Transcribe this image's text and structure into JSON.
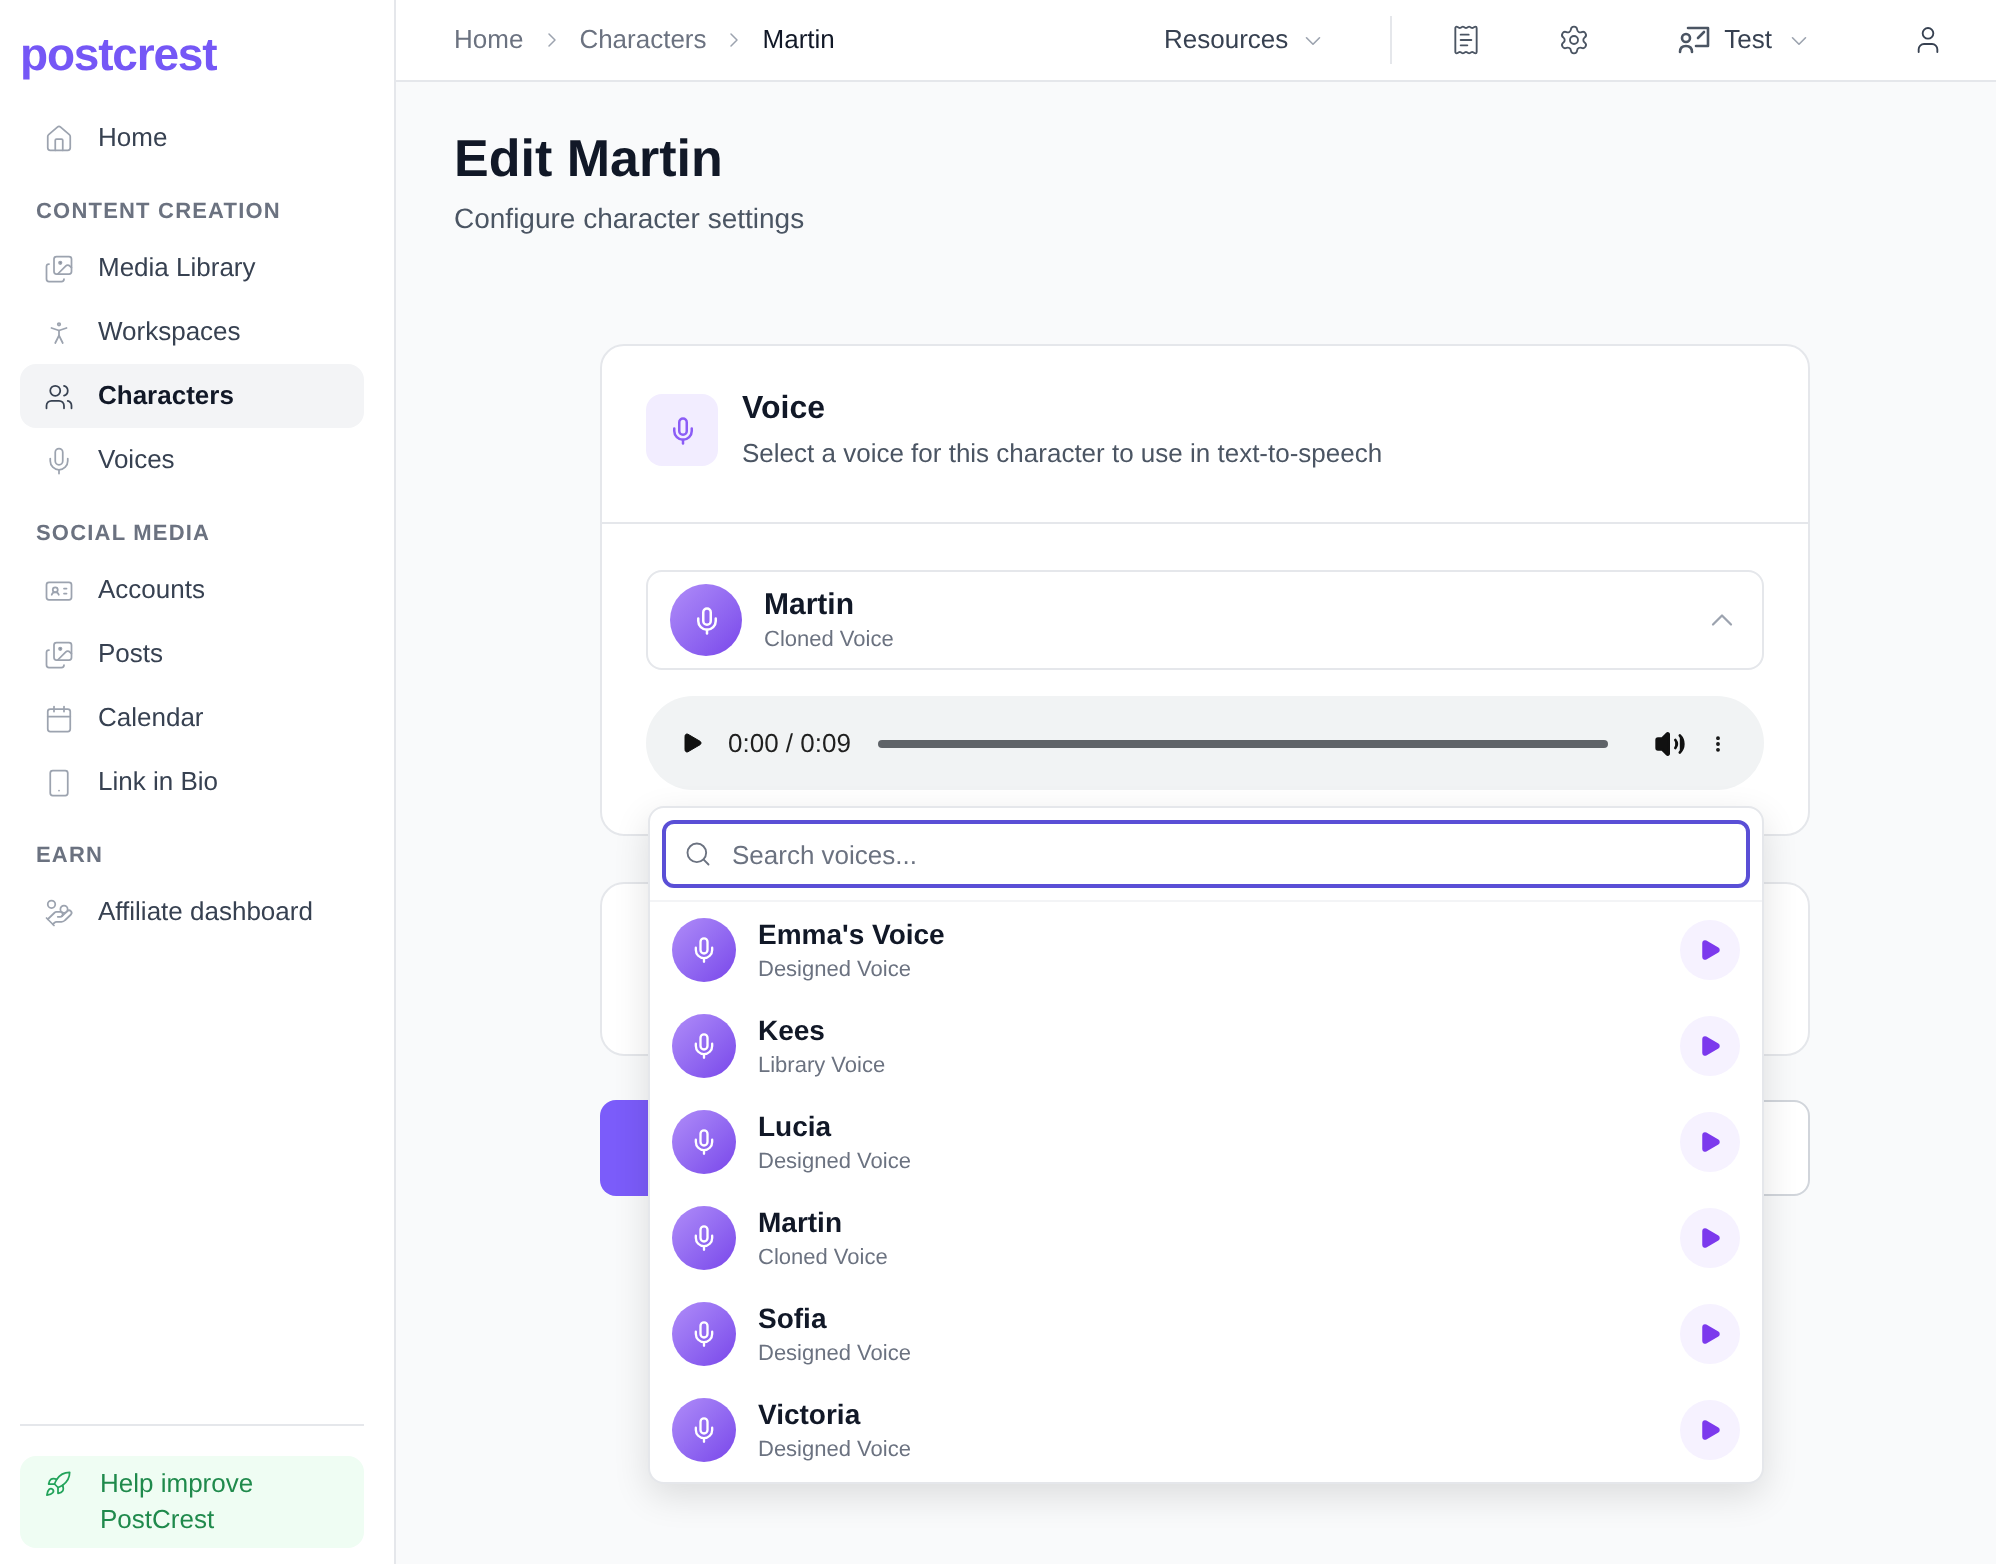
{
  "sidebar": {
    "logo": "postcrest",
    "sections": [
      {
        "items": [
          {
            "label": "Home",
            "selected": false
          }
        ]
      },
      {
        "heading": "CONTENT CREATION",
        "items": [
          {
            "label": "Media Library",
            "selected": false
          },
          {
            "label": "Workspaces",
            "selected": false
          },
          {
            "label": "Characters",
            "selected": true
          },
          {
            "label": "Voices",
            "selected": false
          }
        ]
      },
      {
        "heading": "SOCIAL MEDIA",
        "items": [
          {
            "label": "Accounts",
            "selected": false
          },
          {
            "label": "Posts",
            "selected": false
          },
          {
            "label": "Calendar",
            "selected": false
          },
          {
            "label": "Link in Bio",
            "selected": false
          }
        ]
      },
      {
        "heading": "EARN",
        "items": [
          {
            "label": "Affiliate dashboard",
            "selected": false
          }
        ]
      }
    ],
    "help": {
      "label": "Help improve PostCrest"
    }
  },
  "topbar": {
    "breadcrumb": [
      {
        "label": "Home",
        "current": false
      },
      {
        "label": "Characters",
        "current": false
      },
      {
        "label": "Martin",
        "current": true
      }
    ],
    "resources": "Resources",
    "account": "Test"
  },
  "page": {
    "title": "Edit Martin",
    "subtitle": "Configure character settings"
  },
  "voice_card": {
    "title": "Voice",
    "description": "Select a voice for this character to use in text-to-speech",
    "selected_voice": {
      "name": "Martin",
      "type": "Cloned Voice",
      "expanded": true
    },
    "player": {
      "time": "0:00 / 0:09"
    }
  },
  "voice_dropdown": {
    "search": {
      "placeholder": "Search voices..."
    },
    "voices": [
      {
        "name": "Emma's Voice",
        "type": "Designed Voice"
      },
      {
        "name": "Kees",
        "type": "Library Voice"
      },
      {
        "name": "Lucia",
        "type": "Designed Voice"
      },
      {
        "name": "Martin",
        "type": "Cloned Voice"
      },
      {
        "name": "Sofia",
        "type": "Designed Voice"
      },
      {
        "name": "Victoria",
        "type": "Designed Voice"
      }
    ]
  }
}
